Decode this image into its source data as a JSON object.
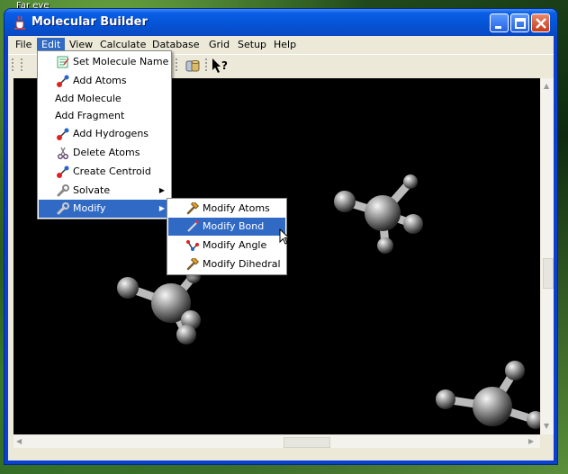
{
  "desktop": {
    "label": "Far eye"
  },
  "window": {
    "title": "Molecular Builder",
    "buttons": {
      "minimize": "minimize",
      "maximize": "maximize",
      "close": "close"
    }
  },
  "menubar": {
    "items": [
      "File",
      "Edit",
      "View",
      "Calculate",
      "Database",
      "Grid",
      "Setup",
      "Help"
    ],
    "active": "Edit"
  },
  "toolbar": {
    "icons": [
      "database-icon",
      "context-help-icon"
    ],
    "help_label": "?"
  },
  "edit_menu": {
    "items": [
      {
        "label": "Set Molecule Name",
        "icon": "notepad-icon"
      },
      {
        "label": "Add Atoms",
        "icon": "atoms-icon"
      },
      {
        "label": "Add Molecule",
        "icon": ""
      },
      {
        "label": "Add Fragment",
        "icon": ""
      },
      {
        "label": "Add Hydrogens",
        "icon": "atoms-icon"
      },
      {
        "label": "Delete Atoms",
        "icon": "scissors-icon"
      },
      {
        "label": "Create Centroid",
        "icon": "atoms-icon"
      },
      {
        "label": "Solvate",
        "icon": "wrench-icon",
        "submenu": true
      },
      {
        "label": "Modify",
        "icon": "wrench-icon",
        "submenu": true,
        "highlighted": true
      }
    ]
  },
  "modify_submenu": {
    "items": [
      {
        "label": "Modify Atoms",
        "icon": "hammer-icon"
      },
      {
        "label": "Modify Bond",
        "icon": "bond-icon",
        "highlighted": true
      },
      {
        "label": "Modify Angle",
        "icon": "angle-icon"
      },
      {
        "label": "Modify Dihedral",
        "icon": "hammer-icon"
      }
    ]
  },
  "colors": {
    "title_blue": "#0453d4",
    "menu_highlight": "#316ac5",
    "canvas": "#000000",
    "chrome": "#ece9d8"
  }
}
